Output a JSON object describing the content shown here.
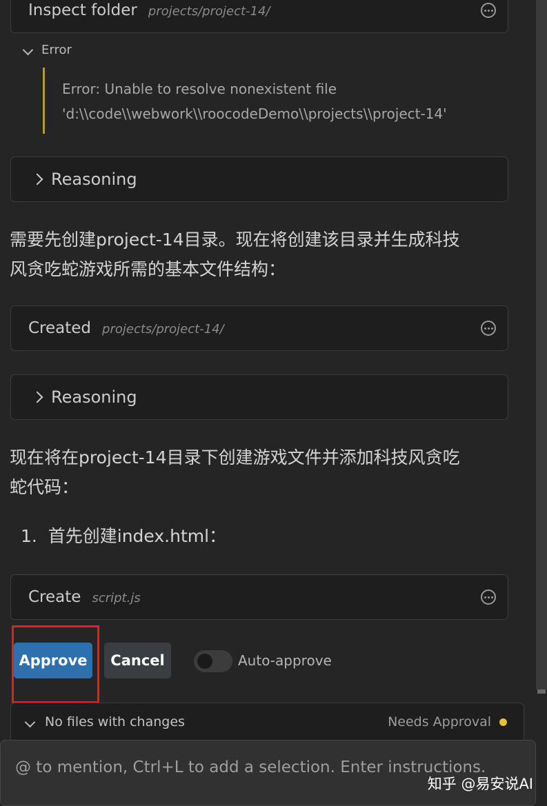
{
  "inspect": {
    "action": "Inspect folder",
    "path": "projects/project-14/"
  },
  "error": {
    "label": "Error",
    "line1": "Error: Unable to resolve nonexistent file",
    "line2": "'d:\\\\code\\\\webwork\\\\roocodeDemo\\\\projects\\\\project-14'"
  },
  "reasoning_label": "Reasoning",
  "message1": {
    "line1": "需要先创建project-14目录。现在将创建该目录并生成科技",
    "line2": "风贪吃蛇游戏所需的基本文件结构："
  },
  "created": {
    "action": "Created",
    "path": "projects/project-14/"
  },
  "message2": {
    "line1": "现在将在project-14目录下创建游戏文件并添加科技风贪吃",
    "line2": "蛇代码："
  },
  "list": {
    "number": "1.",
    "text": "首先创建index.html："
  },
  "create": {
    "action": "Create",
    "path": "script.js"
  },
  "buttons": {
    "approve": "Approve",
    "cancel": "Cancel",
    "auto_approve": "Auto-approve"
  },
  "auto_approve_on": false,
  "changes": {
    "label": "No files with changes",
    "status": "Needs Approval"
  },
  "input": {
    "placeholder": "@ to mention, Ctrl+L to add a selection. Enter instructions..."
  },
  "watermark": "知乎 @易安说AI",
  "colors": {
    "accent": "#2e6fae",
    "highlight_box": "#e8201c",
    "status_dot": "#e5c13a",
    "error_bar": "#b89a2e"
  }
}
